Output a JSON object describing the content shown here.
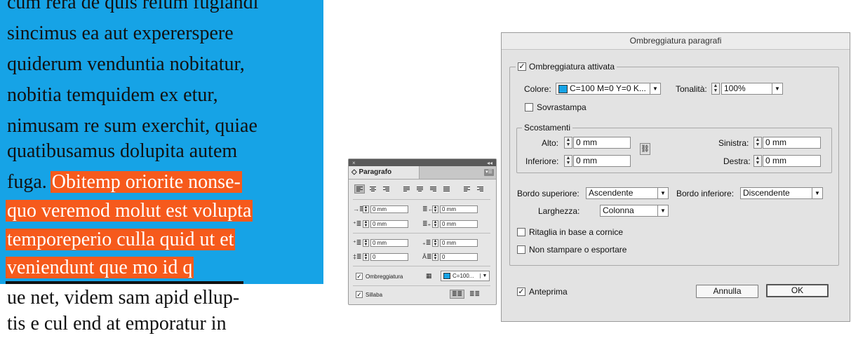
{
  "document": {
    "lines": [
      "cum rera de quis reium fugiandi",
      "sincimus ea aut expererspere",
      "quiderum venduntia nobitatur,",
      "nobitia temquidem ex etur,",
      "nimusam re sum exerchit, quiae",
      "quatibusamus dolupita autem"
    ],
    "line7_plain": "fuga. ",
    "line7_highlight": "Obitemp oriorite nonse-",
    "highlight_lines": [
      "quo veremod molut est volupta",
      "temporeperio culla quid ut et",
      "veniendunt que mo id q"
    ],
    "after_lines": [
      "ue net, videm sam apid ellup-",
      "tis e cul end at emporatur in"
    ],
    "cyan_color": "#16a3e6",
    "orange_color": "#f65a1c"
  },
  "panel": {
    "close_glyph": "×",
    "collapse_glyph": "◂◂",
    "tab_label": "◇ Paragrafo",
    "menu_glyph": "▾☰",
    "left_indent": "0 mm",
    "right_indent": "0 mm",
    "first_line_indent": "0 mm",
    "last_line_indent": "0 mm",
    "space_before": "0 mm",
    "space_after": "0 mm",
    "dropcap_lines": "0",
    "dropcap_chars": "0",
    "shading_label": "Ombreggiatura",
    "shading_color": "C=100...",
    "hyphenation_label": "Sillaba"
  },
  "dialog": {
    "title": "Ombreggiatura paragrafi",
    "shading_enabled_label": "Ombreggiatura attivata",
    "color_label": "Colore:",
    "color_value": "C=100 M=0 Y=0 K...",
    "tint_label": "Tonalità:",
    "tint_value": "100%",
    "overprint_label": "Sovrastampa",
    "offsets_legend": "Scostamenti",
    "top_label": "Alto:",
    "top_value": "0 mm",
    "bottom_label": "Inferiore:",
    "bottom_value": "0 mm",
    "left_label": "Sinistra:",
    "left_value": "0 mm",
    "right_label": "Destra:",
    "right_value": "0 mm",
    "top_edge_label": "Bordo superiore:",
    "top_edge_value": "Ascendente",
    "bottom_edge_label": "Bordo inferiore:",
    "bottom_edge_value": "Discendente",
    "width_label": "Larghezza:",
    "width_value": "Colonna",
    "clip_label": "Ritaglia in base a cornice",
    "noprint_label": "Non stampare o esportare",
    "preview_label": "Anteprima",
    "cancel_label": "Annulla",
    "ok_label": "OK"
  }
}
